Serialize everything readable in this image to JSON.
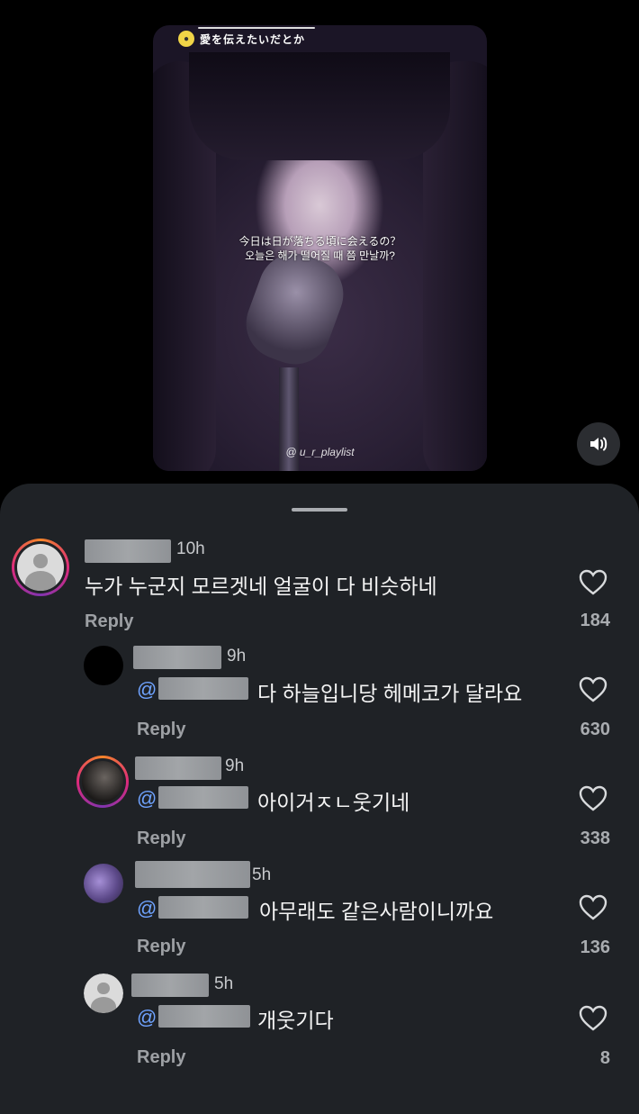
{
  "video": {
    "song_title": "愛を伝えたいだとか",
    "subtitle_jp": "今日は日が落ちる頃に会えるの？",
    "subtitle_kr": "오늘은 해가 떨어질 때 쯤 만날까?",
    "watermark": "@ u_r_playlist",
    "music_icon": "music-disc-icon",
    "sound_icon": "speaker-icon"
  },
  "comments": [
    {
      "time": "10h",
      "text": "누가 누군지 모르겟네 얼굴이 다 비슷하네",
      "reply_label": "Reply",
      "likes": "184",
      "mention": ""
    },
    {
      "time": "9h",
      "text": "다 하늘입니당 헤메코가 달라요",
      "reply_label": "Reply",
      "likes": "630",
      "mention": "@"
    },
    {
      "time": "9h",
      "text": "아이거ㅈㄴ웃기네",
      "reply_label": "Reply",
      "likes": "338",
      "mention": "@"
    },
    {
      "time": "5h",
      "text": "아무래도 같은사람이니까요",
      "reply_label": "Reply",
      "likes": "136",
      "mention": "@"
    },
    {
      "time": "5h",
      "text": "개웃기다",
      "reply_label": "Reply",
      "likes": "8",
      "mention": "@"
    }
  ]
}
